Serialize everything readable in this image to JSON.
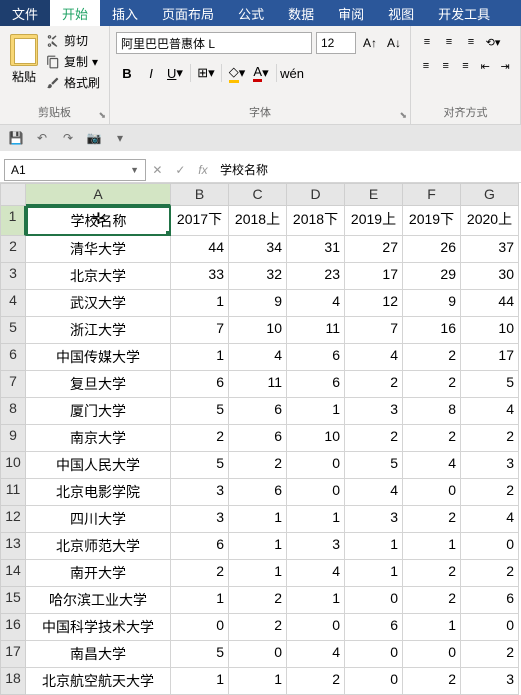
{
  "tabs": {
    "file": "文件",
    "home": "开始",
    "insert": "插入",
    "layout": "页面布局",
    "formula": "公式",
    "data": "数据",
    "review": "审阅",
    "view": "视图",
    "dev": "开发工具"
  },
  "ribbon": {
    "clip": {
      "paste": "粘贴",
      "cut": "剪切",
      "copy": "复制",
      "format": "格式刷",
      "label": "剪贴板"
    },
    "font": {
      "name": "阿里巴巴普惠体 L",
      "size": "12",
      "label": "字体"
    },
    "align": {
      "wrap": "wén",
      "label": "对齐方式"
    }
  },
  "name_box": "A1",
  "formula_bar": "学校名称",
  "columns": [
    "A",
    "B",
    "C",
    "D",
    "E",
    "F",
    "G"
  ],
  "headers": [
    "学校名称",
    "2017下",
    "2018上",
    "2018下",
    "2019上",
    "2019下",
    "2020上"
  ],
  "rows": [
    [
      "清华大学",
      44,
      34,
      31,
      27,
      26,
      37
    ],
    [
      "北京大学",
      33,
      32,
      23,
      17,
      29,
      30
    ],
    [
      "武汉大学",
      1,
      9,
      4,
      12,
      9,
      44
    ],
    [
      "浙江大学",
      7,
      10,
      11,
      7,
      16,
      10
    ],
    [
      "中国传媒大学",
      1,
      4,
      6,
      4,
      2,
      17
    ],
    [
      "复旦大学",
      6,
      11,
      6,
      2,
      2,
      5
    ],
    [
      "厦门大学",
      5,
      6,
      1,
      3,
      8,
      4
    ],
    [
      "南京大学",
      2,
      6,
      10,
      2,
      2,
      2
    ],
    [
      "中国人民大学",
      5,
      2,
      0,
      5,
      4,
      3
    ],
    [
      "北京电影学院",
      3,
      6,
      0,
      4,
      0,
      2
    ],
    [
      "四川大学",
      3,
      1,
      1,
      3,
      2,
      4
    ],
    [
      "北京师范大学",
      6,
      1,
      3,
      1,
      1,
      0
    ],
    [
      "南开大学",
      2,
      1,
      4,
      1,
      2,
      2
    ],
    [
      "哈尔滨工业大学",
      1,
      2,
      1,
      0,
      2,
      6
    ],
    [
      "中国科学技术大学",
      0,
      2,
      0,
      6,
      1,
      0
    ],
    [
      "南昌大学",
      5,
      0,
      4,
      0,
      0,
      2
    ],
    [
      "北京航空航天大学",
      1,
      1,
      2,
      0,
      2,
      3
    ]
  ],
  "chart_data": {
    "type": "table",
    "title": "",
    "columns": [
      "学校名称",
      "2017下",
      "2018上",
      "2018下",
      "2019上",
      "2019下",
      "2020上"
    ],
    "data": [
      [
        "清华大学",
        44,
        34,
        31,
        27,
        26,
        37
      ],
      [
        "北京大学",
        33,
        32,
        23,
        17,
        29,
        30
      ],
      [
        "武汉大学",
        1,
        9,
        4,
        12,
        9,
        44
      ],
      [
        "浙江大学",
        7,
        10,
        11,
        7,
        16,
        10
      ],
      [
        "中国传媒大学",
        1,
        4,
        6,
        4,
        2,
        17
      ],
      [
        "复旦大学",
        6,
        11,
        6,
        2,
        2,
        5
      ],
      [
        "厦门大学",
        5,
        6,
        1,
        3,
        8,
        4
      ],
      [
        "南京大学",
        2,
        6,
        10,
        2,
        2,
        2
      ],
      [
        "中国人民大学",
        5,
        2,
        0,
        5,
        4,
        3
      ],
      [
        "北京电影学院",
        3,
        6,
        0,
        4,
        0,
        2
      ],
      [
        "四川大学",
        3,
        1,
        1,
        3,
        2,
        4
      ],
      [
        "北京师范大学",
        6,
        1,
        3,
        1,
        1,
        0
      ],
      [
        "南开大学",
        2,
        1,
        4,
        1,
        2,
        2
      ],
      [
        "哈尔滨工业大学",
        1,
        2,
        1,
        0,
        2,
        6
      ],
      [
        "中国科学技术大学",
        0,
        2,
        0,
        6,
        1,
        0
      ],
      [
        "南昌大学",
        5,
        0,
        4,
        0,
        0,
        2
      ],
      [
        "北京航空航天大学",
        1,
        1,
        2,
        0,
        2,
        3
      ]
    ]
  }
}
